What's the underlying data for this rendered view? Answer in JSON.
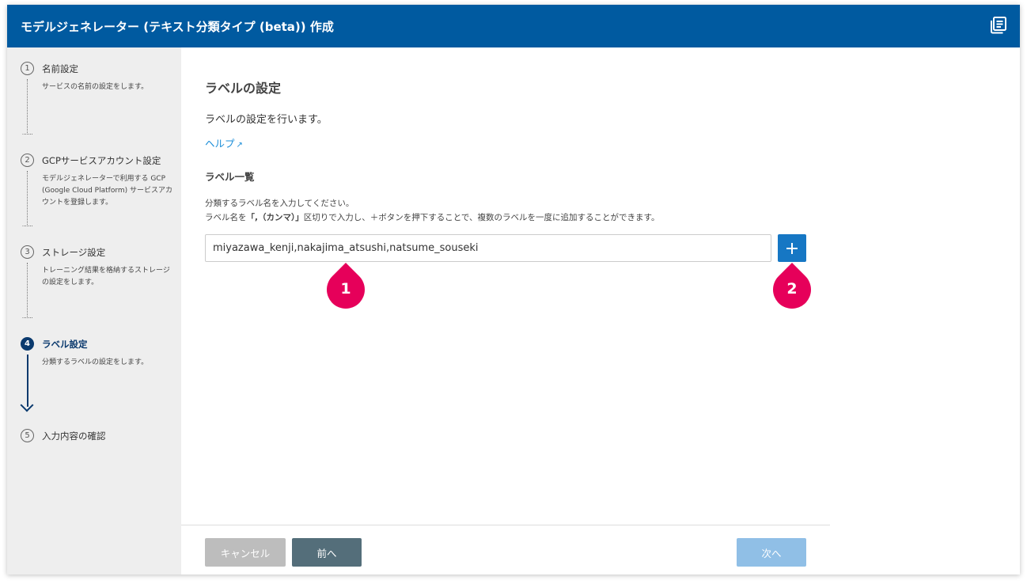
{
  "window": {
    "title": "モデルジェネレーター (テキスト分類タイプ (beta)) 作成",
    "doc_icon": "document-list-icon",
    "accent_color": "#005aa0"
  },
  "sidebar": {
    "steps": [
      {
        "num": "1",
        "title": "名前設定",
        "desc": "サービスの名前の設定をします。",
        "state": "done"
      },
      {
        "num": "2",
        "title": "GCPサービスアカウント設定",
        "desc": "モデルジェネレーターで利用する GCP (Google Cloud Platform) サービスアカウントを登録します。",
        "state": "done"
      },
      {
        "num": "3",
        "title": "ストレージ設定",
        "desc": "トレーニング結果を格納するストレージの設定をします。",
        "state": "done"
      },
      {
        "num": "4",
        "title": "ラベル設定",
        "desc": "分類するラベルの設定をします。",
        "state": "active"
      },
      {
        "num": "5",
        "title": "入力内容の確認",
        "desc": "",
        "state": "pending"
      }
    ]
  },
  "main": {
    "page_title": "ラベルの設定",
    "intro": "ラベルの設定を行います。",
    "help_link": "ヘルプ",
    "section_title": "ラベル一覧",
    "desc_line1": "分類するラベル名を入力してください。",
    "desc_line2_pre": "ラベル名を",
    "desc_line2_bold": "「,（カンマ）」",
    "desc_line2_post": "区切りで入力し、＋ボタンを押下することで、複数のラベルを一度に追加することができます。",
    "label_input_value": "miyazawa_kenji,nakajima_atsushi,natsume_souseki",
    "add_button_icon": "plus-icon"
  },
  "markers": [
    "1",
    "2"
  ],
  "footer": {
    "cancel": "キャンセル",
    "prev": "前へ",
    "next": "次へ"
  }
}
